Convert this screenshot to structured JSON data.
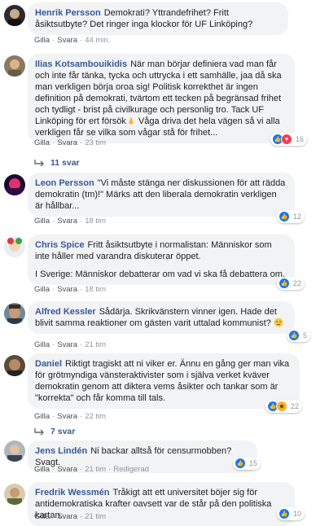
{
  "actions": {
    "like": "Gilla",
    "reply": "Svara",
    "sep": "·",
    "edited": "Redigerad"
  },
  "comments": [
    {
      "author": "Henrik Persson",
      "text": "Demokrati? Yttrandefrihet? Fritt åsiktsutbyte? Det ringer inga klockor för UF Linköping?",
      "time": "44 min."
    },
    {
      "author": "Ilias Kotsambouikidis",
      "text": "När man börjar definiera vad man får och inte får tänka, tycka och uttrycka i ett samhälle, jaa då ska man verkligen börja oroa sig! Politisk korrekthet är ingen definition på demokrati, tvärtom ett tecken på begränsad frihet och tydligt - brist på civilkurage och personlig tro. Tack UF Linköping för ert försök",
      "text2": " Våga driva det hela vägen så vi alla verkligen får se vilka som vågar stå för frihet...",
      "time": "23 tim",
      "reactions": "16",
      "replies": "11 svar"
    },
    {
      "author": "Leon Persson",
      "text": "\"Vi måste stänga ner diskussionen för att rädda demokratin (tm)!\" Märks att den liberala demokratin verkligen är hållbar...",
      "time": "18 tim",
      "reactions": "12"
    },
    {
      "author": "Chris Spice",
      "text": "Fritt åsiktsutbyte i normalistan: Människor som inte håller med varandra diskuterar öppet.",
      "text2": "I Sverige: Människor debatterar om vad vi ska få debattera om.",
      "time": "18 tim",
      "reactions": "22"
    },
    {
      "author": "Alfred Kessler",
      "text": "Sådärja. Skrikvänstern vinner igen. Hade det blivit samma reaktioner om gästen varit uttalad kommunist?",
      "time": "21 tim",
      "reactions": "5"
    },
    {
      "author": "Daniel",
      "text": "Riktigt tragiskt att ni viker er. Ännu en gång ger man vika för grötmyndiga vänsteraktivister som i själva verket kväver demokratin genom att diktera vems åsikter och tankar som är \"korrekta\" och får komma till tals.",
      "time": "22 tim",
      "reactions": "22",
      "replies": "7 svar"
    },
    {
      "author": "Jens Lindén",
      "text": "Ni backar alltså för censurmobben? Svagt.",
      "time": "21 tim",
      "reactions": "15"
    },
    {
      "author": "Fredrik Wessmén",
      "text": "Tråkigt att ett universitet böjer sig för antidemokratiska krafter oavsett var de står på den politiska kartan.",
      "time": "21 tim",
      "reactions": "10"
    }
  ]
}
